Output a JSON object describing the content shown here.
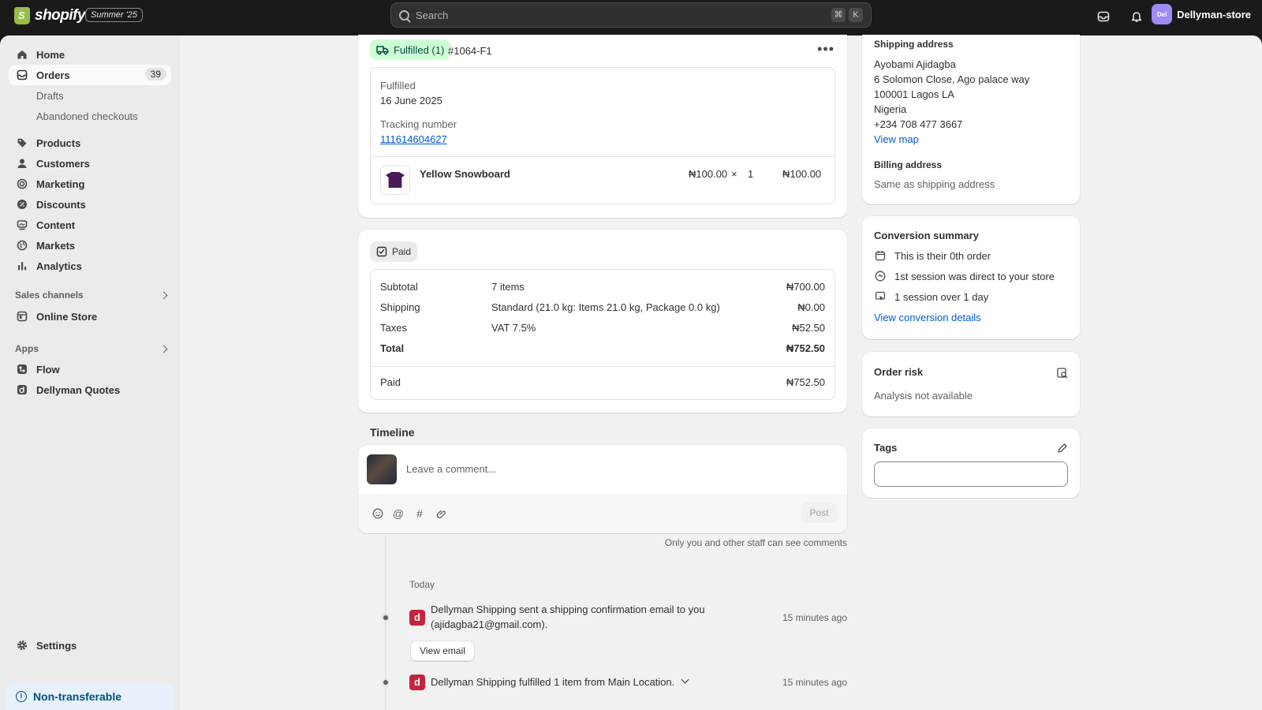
{
  "topbar": {
    "logo_text": "shopify",
    "edition": "Summer '25",
    "search_placeholder": "Search",
    "shortcut_key1": "⌘",
    "shortcut_key2": "K",
    "store_initials": "Del",
    "store_name": "Dellyman-store"
  },
  "sidebar": {
    "items": [
      {
        "label": "Home"
      },
      {
        "label": "Orders",
        "badge": "39"
      },
      {
        "label": "Drafts"
      },
      {
        "label": "Abandoned checkouts"
      },
      {
        "label": "Products"
      },
      {
        "label": "Customers"
      },
      {
        "label": "Marketing"
      },
      {
        "label": "Discounts"
      },
      {
        "label": "Content"
      },
      {
        "label": "Markets"
      },
      {
        "label": "Analytics"
      }
    ],
    "sales_channels_heading": "Sales channels",
    "online_store": "Online Store",
    "apps_heading": "Apps",
    "apps": [
      {
        "label": "Flow"
      },
      {
        "label": "Dellyman Quotes"
      }
    ],
    "settings": "Settings",
    "non_transferable": "Non-transferable"
  },
  "fulfillment": {
    "badge": "Fulfilled (1)",
    "id": "#1064-F1",
    "status_label": "Fulfilled",
    "date": "16 June 2025",
    "tracking_label": "Tracking number",
    "tracking_number": "111614604627",
    "item_name": "Yellow Snowboard",
    "item_price": "₦100.00",
    "item_times": "×",
    "item_qty": "1",
    "item_total": "₦100.00"
  },
  "payment": {
    "badge": "Paid",
    "rows": [
      {
        "label": "Subtotal",
        "detail": "7 items",
        "amount": "₦700.00"
      },
      {
        "label": "Shipping",
        "detail": "Standard (21.0 kg: Items 21.0 kg, Package 0.0 kg)",
        "amount": "₦0.00"
      },
      {
        "label": "Taxes",
        "detail": "VAT 7.5%",
        "amount": "₦52.50"
      },
      {
        "label": "Total",
        "detail": "",
        "amount": "₦752.50"
      }
    ],
    "paid_label": "Paid",
    "paid_amount": "₦752.50"
  },
  "timeline": {
    "heading": "Timeline",
    "comment_placeholder": "Leave a comment...",
    "post": "Post",
    "staff_note": "Only you and other staff can see comments",
    "day": "Today",
    "events": [
      {
        "text_line1": "Dellyman Shipping sent a shipping confirmation email to you",
        "text_line2": "(ajidagba21@gmail.com).",
        "time": "15 minutes ago",
        "action": "View email"
      },
      {
        "text_line1": "Dellyman Shipping fulfilled 1 item from Main Location.",
        "time": "15 minutes ago"
      }
    ]
  },
  "shipping_address": {
    "heading": "Shipping address",
    "lines": [
      "Ayobami Ajidagba",
      "6 Solomon Close, Ago palace way",
      "100001 Lagos LA",
      "Nigeria",
      "+234 708 477 3667"
    ],
    "view_map": "View map",
    "billing_heading": "Billing address",
    "billing_value": "Same as shipping address"
  },
  "conversion": {
    "heading": "Conversion summary",
    "rows": [
      "This is their 0th order",
      "1st session was direct to your store",
      "1 session over 1 day"
    ],
    "link": "View conversion details"
  },
  "risk": {
    "heading": "Order risk",
    "value": "Analysis not available"
  },
  "tags": {
    "heading": "Tags"
  }
}
